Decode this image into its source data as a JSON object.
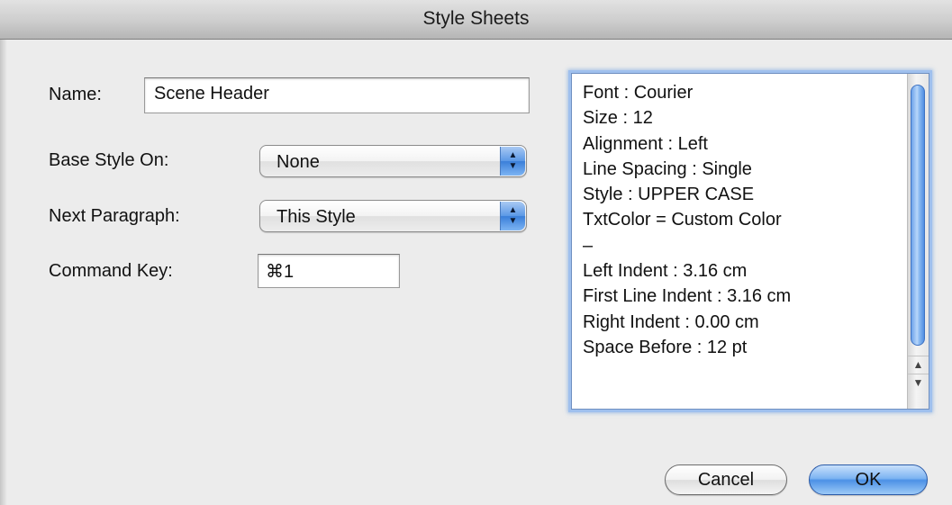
{
  "window": {
    "title": "Style Sheets"
  },
  "form": {
    "name_label": "Name:",
    "name_value": "Scene Header",
    "base_style_label": "Base Style On:",
    "base_style_value": "None",
    "next_paragraph_label": "Next Paragraph:",
    "next_paragraph_value": "This Style",
    "command_key_label": "Command Key:",
    "command_key_value": "⌘1"
  },
  "properties": {
    "lines": [
      "Font : Courier",
      "Size : 12",
      "Alignment : Left",
      "Line Spacing : Single",
      "Style : UPPER CASE",
      "TxtColor = Custom Color",
      "–",
      "Left Indent : 3.16 cm",
      "First Line Indent : 3.16 cm",
      "Right Indent : 0.00 cm",
      "Space Before : 12 pt"
    ]
  },
  "buttons": {
    "cancel_label": "Cancel",
    "ok_label": "OK"
  },
  "icons": {
    "stepper": "up-down-arrows-icon",
    "scroll_up": "scroll-up-arrow-icon",
    "scroll_down": "scroll-down-arrow-icon"
  },
  "colors": {
    "accent": "#5b98e6",
    "window_bg": "#ececec"
  }
}
